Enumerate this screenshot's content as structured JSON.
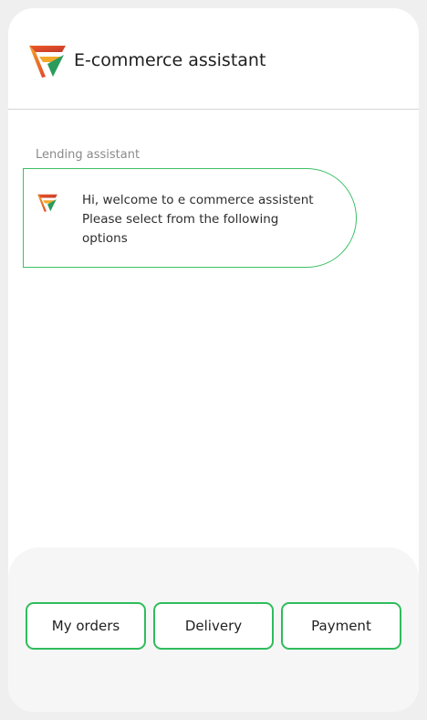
{
  "header": {
    "title": "E-commerce assistant",
    "logo_icon": "brand-logo-icon"
  },
  "chat": {
    "sender_label": "Lending assistant",
    "message_lines": [
      "Hi, welcome to e commerce assistent",
      "Please select from the following",
      "options"
    ]
  },
  "options": [
    {
      "label": "My orders"
    },
    {
      "label": "Delivery"
    },
    {
      "label": "Payment"
    }
  ],
  "colors": {
    "accent_green": "#3cc068",
    "logo_orange": "#f05a28",
    "logo_yellow": "#f4a82a",
    "logo_green": "#2a9b5c"
  }
}
